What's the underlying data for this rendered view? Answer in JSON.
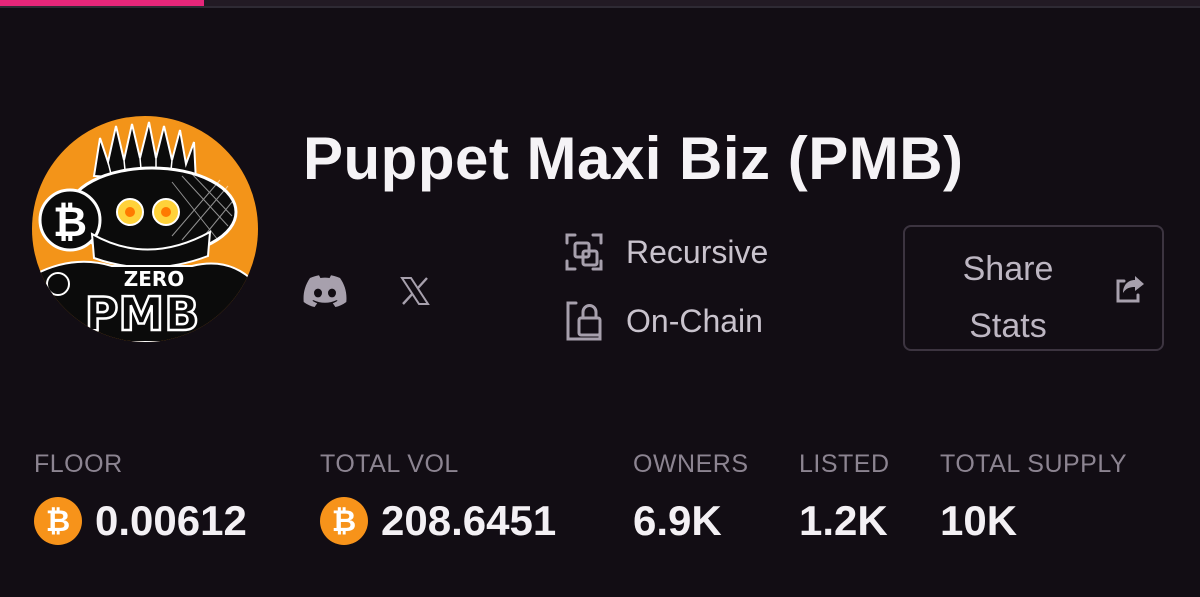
{
  "progress": {
    "value_fraction": 0.17,
    "color": "#e6267a"
  },
  "collection": {
    "title": "Puppet Maxi Biz (PMB)",
    "avatar_text_top": "ZERO",
    "avatar_text_bottom": "PMB"
  },
  "socials": [
    {
      "name": "discord-icon"
    },
    {
      "name": "x-icon"
    }
  ],
  "features": [
    {
      "label": "Recursive",
      "icon": "recursive-icon"
    },
    {
      "label": "On-Chain",
      "icon": "on-chain-icon"
    }
  ],
  "share": {
    "line1": "Share",
    "line2": "Stats",
    "icon": "share-icon"
  },
  "stats": {
    "floor": {
      "label": "FLOOR",
      "value": "0.00612",
      "currency_icon": "bitcoin-icon"
    },
    "total_vol": {
      "label": "TOTAL VOL",
      "value": "208.6451",
      "currency_icon": "bitcoin-icon"
    },
    "owners": {
      "label": "OWNERS",
      "value": "6.9K"
    },
    "listed": {
      "label": "LISTED",
      "value": "1.2K"
    },
    "total_supply": {
      "label": "TOTAL SUPPLY",
      "value": "10K"
    }
  },
  "colors": {
    "background": "#120d14",
    "accent": "#e6267a",
    "bitcoin": "#f7931a",
    "avatar_bg": "#f39419"
  }
}
